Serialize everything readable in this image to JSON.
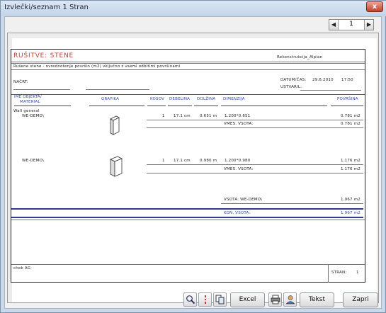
{
  "window": {
    "title": "Izvlečki/seznam 1 Stran",
    "close_label": "x"
  },
  "pager": {
    "prev": "◀",
    "next": "▶",
    "page": "1"
  },
  "report": {
    "title": "RUŠITVE: STENE",
    "project": "Rekonstrukcija_Alpian",
    "subtitle": "Rušene stene - ovrednotenje površin (m2) vključno z vsemi odbitimi površinami",
    "nacrt_label": "NAČRT:",
    "datum_label": "DATUM/ČAS:",
    "datum_value": "29.6.2010",
    "time_value": "17:50",
    "ustvaril_label": "USTVARIL:",
    "columns": {
      "name": "IME OBJEKTA/",
      "material": "MATERIAL",
      "grafika": "GRAFIKA",
      "kosov": "KOSOV",
      "debelina": "DEBELINA",
      "dolzina": "DOLŽINA",
      "dimenzija": "DIMENZIJA",
      "povrsina": "POVRŠINA"
    },
    "group_label": "Wall general",
    "rows": [
      {
        "name": "WE-DEMO\\",
        "kosov": "1",
        "debelina": "17.1 cm",
        "dolzina": "0.651 m",
        "dimenzija": "1.200*0.651",
        "povrsina": "0.781 m2",
        "vmes_label": "VMES. VSOTA:",
        "vmes_value": "0.781 m2"
      },
      {
        "name": "WE-DEMO\\",
        "kosov": "1",
        "debelina": "17.1 cm",
        "dolzina": "0.980 m",
        "dimenzija": "1.200*0.980",
        "povrsina": "1.176 m2",
        "vmes_label": "VMES. VSOTA:",
        "vmes_value": "1.176 m2"
      }
    ],
    "vsota_label": "VSOTA: WE-DEMO\\",
    "vsota_value": "1.967 m2",
    "kon_label": "KON. VSOTA:",
    "kon_value": "1.967 m2",
    "footer_left": "chek AG",
    "stran_label": "STRAN:",
    "stran_value": "1"
  },
  "toolbar": {
    "zoom_icon": "magnifier-icon",
    "settings_icon": "list-settings-icon",
    "copy_icon": "copy-icon",
    "print_icon": "printer-icon",
    "user_icon": "user-icon",
    "excel_label": "Excel",
    "tekst_label": "Tekst",
    "zapri_label": "Zapri"
  },
  "colors": {
    "accent_blue": "#2a3f8c",
    "title_red": "#c6392d",
    "window_frame": "#c9d9ea"
  }
}
